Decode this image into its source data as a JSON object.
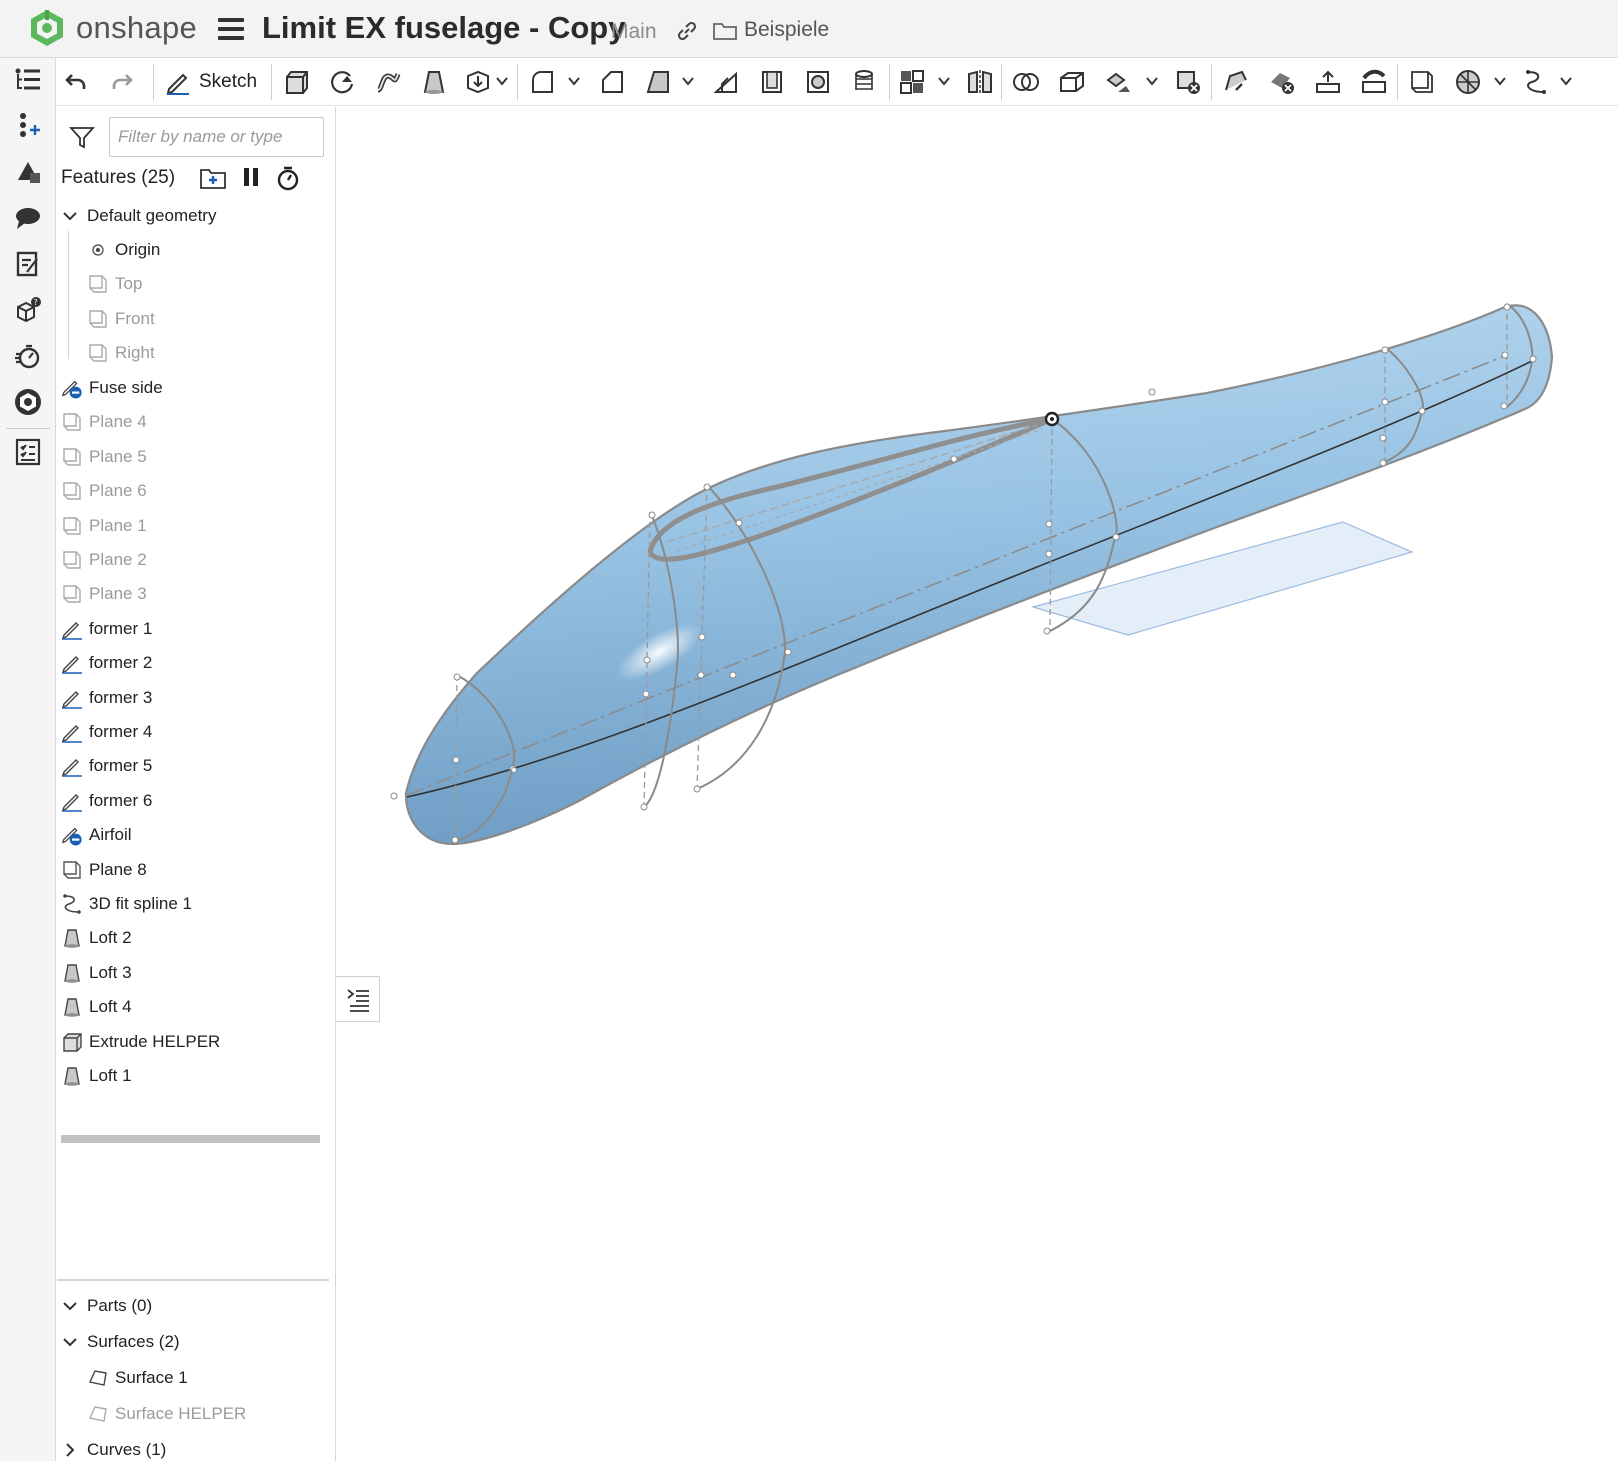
{
  "app": {
    "name": "onshape"
  },
  "document": {
    "title": "Limit EX fuselage - Copy",
    "branch": "Main",
    "folder": "Beispiele"
  },
  "toolbar": {
    "sketch_label": "Sketch"
  },
  "filter": {
    "placeholder": "Filter by name or type"
  },
  "features": {
    "header": "Features (25)",
    "default_geometry": "Default geometry",
    "defaults": [
      {
        "label": "Origin",
        "icon": "origin-icon"
      },
      {
        "label": "Top",
        "icon": "plane-icon"
      },
      {
        "label": "Front",
        "icon": "plane-icon"
      },
      {
        "label": "Right",
        "icon": "plane-icon"
      }
    ],
    "items": [
      {
        "label": "Fuse side",
        "icon": "sketch-suppressed-icon",
        "dim": false
      },
      {
        "label": "Plane 4",
        "icon": "plane-icon",
        "dim": true
      },
      {
        "label": "Plane 5",
        "icon": "plane-icon",
        "dim": true
      },
      {
        "label": "Plane 6",
        "icon": "plane-icon",
        "dim": true
      },
      {
        "label": "Plane 1",
        "icon": "plane-icon",
        "dim": true
      },
      {
        "label": "Plane 2",
        "icon": "plane-icon",
        "dim": true
      },
      {
        "label": "Plane 3",
        "icon": "plane-icon",
        "dim": true
      },
      {
        "label": "former 1",
        "icon": "sketch-icon",
        "dim": false
      },
      {
        "label": "former 2",
        "icon": "sketch-icon",
        "dim": false
      },
      {
        "label": "former 3",
        "icon": "sketch-icon",
        "dim": false
      },
      {
        "label": "former 4",
        "icon": "sketch-icon",
        "dim": false
      },
      {
        "label": "former 5",
        "icon": "sketch-icon",
        "dim": false
      },
      {
        "label": "former 6",
        "icon": "sketch-icon",
        "dim": false
      },
      {
        "label": "Airfoil",
        "icon": "sketch-suppressed-icon",
        "dim": false
      },
      {
        "label": "Plane 8",
        "icon": "plane-icon",
        "dim": false
      },
      {
        "label": "3D fit spline 1",
        "icon": "spline-icon",
        "dim": false
      },
      {
        "label": "Loft 2",
        "icon": "loft-icon",
        "dim": false
      },
      {
        "label": "Loft 3",
        "icon": "loft-icon",
        "dim": false
      },
      {
        "label": "Loft 4",
        "icon": "loft-icon",
        "dim": false
      },
      {
        "label": "Extrude HELPER",
        "icon": "extrude-icon",
        "dim": false
      },
      {
        "label": "Loft 1",
        "icon": "loft-icon",
        "dim": false
      }
    ]
  },
  "parts_list": {
    "parts": "Parts (0)",
    "surfaces": "Surfaces (2)",
    "surface_items": [
      {
        "label": "Surface 1",
        "dim": false
      },
      {
        "label": "Surface HELPER",
        "dim": true
      }
    ],
    "curves": "Curves (1)"
  },
  "colors": {
    "accent": "#1a5fb4",
    "logo_green": "#5cb85c",
    "model_blue": "#9cc4e2"
  }
}
